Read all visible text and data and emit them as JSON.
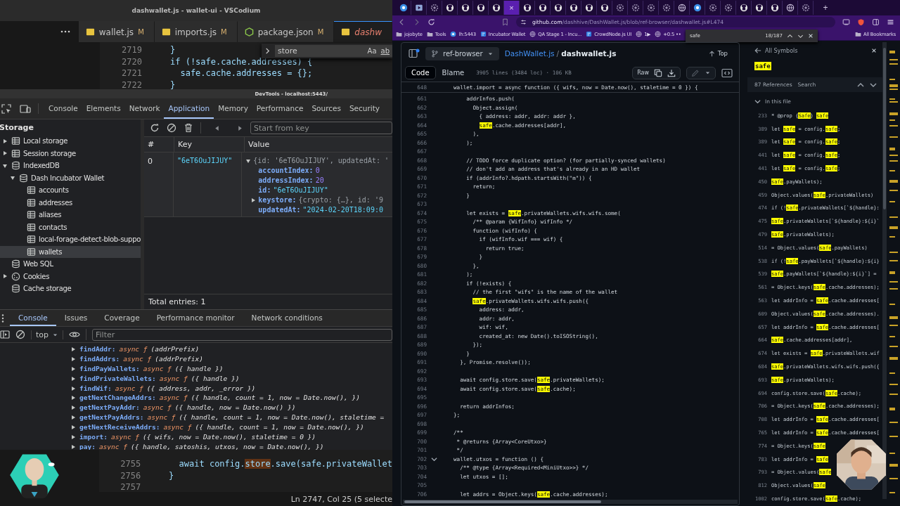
{
  "vscodium": {
    "title": "dashwallet.js - wallet-ui - VSCodium",
    "tabs": [
      {
        "kind": "js",
        "label": "wallet.js",
        "badge": "M",
        "selected": false
      },
      {
        "kind": "js",
        "label": "imports.js",
        "badge": "M",
        "selected": false
      },
      {
        "kind": "json",
        "label": "package.json",
        "badge": "M",
        "selected": false
      },
      {
        "kind": "js",
        "label": "dashw",
        "selected": true
      }
    ],
    "editor_top": [
      {
        "n": "2719",
        "text": "}"
      },
      {
        "n": "2720",
        "text": "if (!safe.cache.addresses) {"
      },
      {
        "n": "2721",
        "text": "  safe.cache.addresses = {};"
      },
      {
        "n": "2722",
        "text": "}"
      }
    ],
    "find": {
      "value": "store",
      "case_toggle": "Aa",
      "word_toggle": "ab"
    },
    "editor_bottom": [
      {
        "n": "2755",
        "parts": [
          "  await config.",
          {
            "match": "store"
          },
          ".save(safe.privateWallet"
        ]
      },
      {
        "n": "2756",
        "parts": [
          "}"
        ]
      },
      {
        "n": "2757"
      }
    ],
    "status": "Ln 2747, Col 25 (5 selecte"
  },
  "devtools": {
    "title": "DevTools - localhost:5443/",
    "tabs": [
      {
        "label": "Console",
        "selected": false
      },
      {
        "label": "Elements",
        "selected": false
      },
      {
        "label": "Network",
        "selected": false
      },
      {
        "label": "Application",
        "selected": true
      },
      {
        "label": "Memory",
        "selected": false
      },
      {
        "label": "Performance",
        "selected": false
      },
      {
        "label": "Sources",
        "selected": false
      },
      {
        "label": "Security",
        "selected": false
      }
    ],
    "sidebar": {
      "heading": "Storage",
      "items": [
        {
          "label": "Local storage",
          "kind": "table",
          "expanded": false,
          "selected": false
        },
        {
          "label": "Session storage",
          "kind": "table",
          "expanded": false,
          "selected": false
        },
        {
          "label": "IndexedDB",
          "kind": "db",
          "expanded": true,
          "selected": false,
          "children": [
            {
              "label": "Dash Incubator Wallet",
              "kind": "db",
              "expanded": true,
              "selected": false,
              "children": [
                {
                  "label": "accounts",
                  "kind": "table",
                  "selected": false
                },
                {
                  "label": "addresses",
                  "kind": "table",
                  "selected": false
                },
                {
                  "label": "aliases",
                  "kind": "table",
                  "selected": false
                },
                {
                  "label": "contacts",
                  "kind": "table",
                  "selected": false
                },
                {
                  "label": "local-forage-detect-blob-suppo",
                  "kind": "table",
                  "selected": false
                },
                {
                  "label": "wallets",
                  "kind": "table",
                  "selected": true
                }
              ]
            }
          ]
        },
        {
          "label": "Web SQL",
          "kind": "db",
          "selected": false
        },
        {
          "label": "Cookies",
          "kind": "cookie",
          "expanded": false,
          "selected": false
        },
        {
          "label": "Cache storage",
          "kind": "db",
          "selected": false
        }
      ]
    },
    "key_filter": {
      "placeholder": "Start from key"
    },
    "table": {
      "columns": [
        "#",
        "Key",
        "Value"
      ],
      "rows": [
        {
          "index": "0",
          "key": "\"6eT6OuJIJUY\"",
          "value": [
            {
              "text": "{id: '6eT6OuJIJUY', updatedAt: '",
              "expanded": true
            },
            {
              "key": "accountIndex:",
              "value": "0",
              "kind": "number"
            },
            {
              "key": "addressIndex:",
              "value": "20",
              "kind": "number"
            },
            {
              "key": "id:",
              "value": "\"6eT6OuJIJUY\"",
              "kind": "string"
            },
            {
              "key": "keystore:",
              "value": "{crypto: {…}, id: '9",
              "kind": "object",
              "expanded": false
            },
            {
              "key": "updatedAt:",
              "value": "\"2024-02-20T18:09:0",
              "kind": "string"
            }
          ]
        }
      ]
    },
    "total": "Total entries: 1",
    "drawer_tabs": [
      {
        "label": "Console",
        "selected": true
      },
      {
        "label": "Issues",
        "selected": false
      },
      {
        "label": "Coverage",
        "selected": false
      },
      {
        "label": "Performance monitor",
        "selected": false
      },
      {
        "label": "Network conditions",
        "selected": false
      }
    ],
    "context": "top",
    "filter": {
      "placeholder": "Filter"
    },
    "console": [
      {
        "name": "findAddr:",
        "type": "async ƒ",
        "params": "(addrPrefix)"
      },
      {
        "name": "findAddrs:",
        "type": "async ƒ",
        "params": "(addrPrefix)"
      },
      {
        "name": "findPayWallets:",
        "type": "async ƒ",
        "params": "({ handle })"
      },
      {
        "name": "findPrivateWallets:",
        "type": "async ƒ",
        "params": "({ handle })"
      },
      {
        "name": "findWif:",
        "type": "async ƒ",
        "params": "({ address, addr, _error })"
      },
      {
        "name": "getNextChangeAddrs:",
        "type": "async ƒ",
        "params": "({ handle, count = 1, now = Date.now(), })"
      },
      {
        "name": "getNextPayAddr:",
        "type": "async ƒ",
        "params": "({ handle, now = Date.now() })"
      },
      {
        "name": "getNextPayAddrs:",
        "type": "async ƒ",
        "params": "({ handle, count = 1, now = Date.now(), staletime ="
      },
      {
        "name": "getNextReceiveAddrs:",
        "type": "async ƒ",
        "params": "({ handle, count = 1, now = Date.now(), })"
      },
      {
        "name": "import:",
        "type": "async ƒ",
        "params": "({ wifs, now = Date.now(), staletime = 0 })"
      },
      {
        "name": "pay:",
        "type": "async ƒ",
        "params": "({ handle, satoshis, utxos, now = Date.now(), })"
      }
    ]
  },
  "browser": {
    "tabs": [
      {
        "kind": "dash",
        "selected": false
      },
      {
        "kind": "media",
        "selected": false
      },
      {
        "kind": "gear",
        "selected": false
      },
      {
        "kind": "github",
        "selected": false
      },
      {
        "kind": "github",
        "selected": false
      },
      {
        "kind": "github",
        "selected": false
      },
      {
        "kind": "github",
        "selected": false
      },
      {
        "selected": true,
        "close": "×"
      },
      {
        "kind": "github",
        "selected": false
      },
      {
        "kind": "github",
        "selected": false
      },
      {
        "kind": "github",
        "selected": false
      },
      {
        "kind": "github",
        "selected": false
      },
      {
        "kind": "github",
        "selected": false
      },
      {
        "kind": "github",
        "selected": false
      },
      {
        "kind": "gear",
        "selected": false
      },
      {
        "kind": "gear",
        "selected": false
      },
      {
        "kind": "gear",
        "selected": false
      },
      {
        "kind": "gear",
        "selected": false
      },
      {
        "kind": "globe",
        "selected": false
      },
      {
        "kind": "dash",
        "selected": false
      },
      {
        "kind": "gear",
        "selected": false
      },
      {
        "kind": "gear",
        "selected": false
      },
      {
        "kind": "github",
        "selected": false
      },
      {
        "kind": "github",
        "selected": false
      },
      {
        "kind": "github",
        "selected": false
      },
      {
        "kind": "globe",
        "selected": false
      },
      {
        "kind": "gear",
        "selected": false
      }
    ],
    "new_tab": "+",
    "url_host": "github.com",
    "url_path": "/dashhive/DashWallet.js/blob/ref-browser/dashwallet.js#L474",
    "bookmarks": [
      {
        "kind": "folder",
        "label": "jojobyte"
      },
      {
        "kind": "folder",
        "label": "Tools"
      },
      {
        "kind": "dash",
        "label": "lh:5443"
      },
      {
        "kind": "app",
        "label": "Incubator Wallet"
      },
      {
        "kind": "globe",
        "label": "QA Stage 1 - Incu..."
      },
      {
        "kind": "app",
        "label": "CrowdNode.js UI"
      },
      {
        "kind": "globe",
        "label": "1▶"
      },
      {
        "kind": "globe",
        "label": "+0.5 ••"
      }
    ],
    "all_bookmarks": "All Bookmarks",
    "find": {
      "value": "safe",
      "count": "18/187"
    },
    "github": {
      "branch": "ref-browser",
      "repo": "DashWallet.js",
      "sep": "/",
      "file": "dashwallet.js",
      "top": "Top",
      "views": [
        {
          "label": "Code",
          "selected": true
        },
        {
          "label": "Blame",
          "selected": false
        }
      ],
      "stats": "3905 lines (3484 loc) · 106 KB",
      "raw": "Raw",
      "sticky": {
        "n": "648",
        "parts": [
          "wallet.import = async function ({ wifs, now = Date.now(), staletime = 0 }) {"
        ]
      },
      "lines": [
        {
          "n": "661",
          "fold": false,
          "parts": [
            "    addrInfos.push("
          ]
        },
        {
          "n": "662",
          "fold": false,
          "parts": [
            "      Object.assign("
          ]
        },
        {
          "n": "663",
          "fold": false,
          "parts": [
            "        { address: addr, addr: addr },"
          ]
        },
        {
          "n": "664",
          "fold": false,
          "parts": [
            {
              "hl": "safe"
            },
            ".cache.addresses[addr],"
          ]
        },
        {
          "n": "665",
          "fold": false,
          "parts": [
            "      ),"
          ]
        },
        {
          "n": "666",
          "fold": false,
          "parts": [
            "    );"
          ]
        },
        {
          "n": "667",
          "fold": false
        },
        {
          "n": "668",
          "fold": false,
          "parts": [
            "    // TODO force duplicate option? (for partially-synced wallets)"
          ]
        },
        {
          "n": "669",
          "fold": false,
          "parts": [
            "    // don't add an address that's already in an HD wallet"
          ]
        },
        {
          "n": "670",
          "fold": false,
          "parts": [
            "    if (addrInfo?.hdpath.startsWith(\"m\")) {"
          ]
        },
        {
          "n": "671",
          "fold": false,
          "parts": [
            "      return;"
          ]
        },
        {
          "n": "672",
          "fold": false,
          "parts": [
            "    }"
          ]
        },
        {
          "n": "673",
          "fold": false
        },
        {
          "n": "674",
          "fold": false,
          "parts": [
            "    let exists = ",
            {
              "hl": "safe"
            },
            ".privateWallets.wifs.wifs.some("
          ]
        },
        {
          "n": "675",
          "fold": false,
          "parts": [
            "      /** @param {WifInfo} wifInfo */"
          ]
        },
        {
          "n": "676",
          "fold": false,
          "parts": [
            "      function (wifInfo) {"
          ]
        },
        {
          "n": "677",
          "fold": false,
          "parts": [
            "        if (wifInfo.wif === wif) {"
          ]
        },
        {
          "n": "678",
          "fold": false,
          "parts": [
            "          return true;"
          ]
        },
        {
          "n": "679",
          "fold": false,
          "parts": [
            "        }"
          ]
        },
        {
          "n": "680",
          "fold": false,
          "parts": [
            "      },"
          ]
        },
        {
          "n": "681",
          "fold": false,
          "parts": [
            "    );"
          ]
        },
        {
          "n": "682",
          "fold": false,
          "parts": [
            "    if (!exists) {"
          ]
        },
        {
          "n": "683",
          "fold": false,
          "parts": [
            "      // the first \"wifs\" is the name of the wallet"
          ]
        },
        {
          "n": "684",
          "fold": false,
          "parts": [
            {
              "hl": "safe"
            },
            ".privateWallets.wifs.wifs.push({"
          ]
        },
        {
          "n": "685",
          "fold": false,
          "parts": [
            "        address: addr,"
          ]
        },
        {
          "n": "686",
          "fold": false,
          "parts": [
            "        addr: addr,"
          ]
        },
        {
          "n": "687",
          "fold": false,
          "parts": [
            "        wif: wif,"
          ]
        },
        {
          "n": "688",
          "fold": false,
          "parts": [
            "        created_at: new Date().toISOString(),"
          ]
        },
        {
          "n": "689",
          "fold": false,
          "parts": [
            "      });"
          ]
        },
        {
          "n": "690",
          "fold": false,
          "parts": [
            "    }"
          ]
        },
        {
          "n": "691",
          "fold": false,
          "parts": [
            "  }, Promise.resolve());"
          ]
        },
        {
          "n": "692",
          "fold": false
        },
        {
          "n": "693",
          "fold": false,
          "parts": [
            "  await config.store.save(",
            {
              "hl": "safe"
            },
            ".privateWallets);"
          ]
        },
        {
          "n": "694",
          "fold": false,
          "parts": [
            "  await config.store.save(",
            {
              "hl": "safe"
            },
            ".cache);"
          ]
        },
        {
          "n": "695",
          "fold": false
        },
        {
          "n": "696",
          "fold": false,
          "parts": [
            "  return addrInfos;"
          ]
        },
        {
          "n": "697",
          "fold": false,
          "parts": [
            "};"
          ]
        },
        {
          "n": "698",
          "fold": false
        },
        {
          "n": "699",
          "fold": false,
          "parts": [
            "/**"
          ]
        },
        {
          "n": "700",
          "fold": false,
          "parts": [
            " * @returns {Array<CoreUtxo>}"
          ]
        },
        {
          "n": "701",
          "fold": false,
          "parts": [
            " */"
          ]
        },
        {
          "n": "702",
          "fold": true,
          "parts": [
            "wallet.utxos = function () {"
          ]
        },
        {
          "n": "703",
          "fold": false,
          "parts": [
            "  /** @type {Array<Required<MiniUtxo>>} */"
          ]
        },
        {
          "n": "704",
          "fold": false,
          "parts": [
            "  let utxos = [];"
          ]
        },
        {
          "n": "705",
          "fold": false
        },
        {
          "n": "706",
          "fold": false,
          "parts": [
            "  let addrs = Object.keys(",
            {
              "hl": "safe"
            },
            ".cache.addresses);"
          ]
        }
      ]
    },
    "symbols": {
      "back": "All Symbols",
      "symbol": "safe",
      "count": "87 References",
      "search": "Search",
      "group": "In this file",
      "refs": [
        {
          "n": "233",
          "parts": [
            "* @prop {",
            {
              "hl": "Safe"
            },
            "} ",
            {
              "hl": "safe"
            }
          ]
        },
        {
          "n": "389",
          "parts": [
            "let ",
            {
              "hl": "safe"
            },
            " = config.",
            {
              "hl": "safe"
            },
            ";"
          ]
        },
        {
          "n": "389",
          "parts": [
            "let ",
            {
              "hl": "safe"
            },
            " = config.",
            {
              "hl": "safe"
            },
            ";"
          ]
        },
        {
          "n": "441",
          "parts": [
            "let ",
            {
              "hl": "safe"
            },
            " = config.",
            {
              "hl": "safe"
            },
            ";"
          ]
        },
        {
          "n": "441",
          "parts": [
            "let ",
            {
              "hl": "safe"
            },
            " = config.",
            {
              "hl": "safe"
            },
            ";"
          ]
        },
        {
          "n": "450",
          "parts": [
            {
              "hl": "safe"
            },
            ".payWallets);"
          ]
        },
        {
          "n": "459",
          "parts": [
            "Object.values(",
            {
              "hl": "safe"
            },
            ".privateWallets)"
          ]
        },
        {
          "n": "474",
          "parts": [
            "if (!",
            {
              "hl": "safe"
            },
            ".privateWallets[`${handle}:"
          ]
        },
        {
          "n": "475",
          "parts": [
            {
              "hl": "safe"
            },
            ".privateWallets[`${handle}:${i}`"
          ]
        },
        {
          "n": "479",
          "parts": [
            {
              "hl": "safe"
            },
            ".privateWallets);"
          ]
        },
        {
          "n": "514",
          "parts": [
            "= Object.values(",
            {
              "hl": "safe"
            },
            ".payWallets)"
          ]
        },
        {
          "n": "538",
          "parts": [
            "if (!",
            {
              "hl": "safe"
            },
            ".payWallets[`${handle}:${i}"
          ]
        },
        {
          "n": "539",
          "parts": [
            {
              "hl": "safe"
            },
            ".payWallets[`${handle}:${i}`] ="
          ]
        },
        {
          "n": "561",
          "parts": [
            "= Object.keys(",
            {
              "hl": "safe"
            },
            ".cache.addresses);"
          ]
        },
        {
          "n": "563",
          "parts": [
            "let addrInfo = ",
            {
              "hl": "safe"
            },
            ".cache.addresses["
          ]
        },
        {
          "n": "609",
          "parts": [
            "Object.values(",
            {
              "hl": "safe"
            },
            ".cache.addresses)."
          ]
        },
        {
          "n": "657",
          "parts": [
            "let addrInfo = ",
            {
              "hl": "safe"
            },
            ".cache.addresses["
          ]
        },
        {
          "n": "664",
          "parts": [
            {
              "hl": "safe"
            },
            ".cache.addresses[addr],"
          ]
        },
        {
          "n": "674",
          "parts": [
            "let exists = ",
            {
              "hl": "safe"
            },
            ".privateWallets.wif"
          ]
        },
        {
          "n": "684",
          "parts": [
            {
              "hl": "safe"
            },
            ".privateWallets.wifs.wifs.push({"
          ]
        },
        {
          "n": "693",
          "parts": [
            {
              "hl": "safe"
            },
            ".privateWallets);"
          ]
        },
        {
          "n": "694",
          "parts": [
            "config.store.save(",
            {
              "hl": "safe"
            },
            ".cache);"
          ]
        },
        {
          "n": "706",
          "parts": [
            "= Object.keys(",
            {
              "hl": "safe"
            },
            ".cache.addresses);"
          ]
        },
        {
          "n": "708",
          "parts": [
            "let addrInfo = ",
            {
              "hl": "safe"
            },
            ".cache.addresses["
          ]
        },
        {
          "n": "765",
          "parts": [
            "let addrInfo = ",
            {
              "hl": "safe"
            },
            ".cache.addresses["
          ]
        },
        {
          "n": "774",
          "parts": [
            "= Object.keys(",
            {
              "hl": "safe"
            }
          ]
        },
        {
          "n": "783",
          "parts": [
            "let addrInfo = ",
            {
              "hl": "safe"
            }
          ]
        },
        {
          "n": "793",
          "parts": [
            "= Object.values(",
            {
              "hl": "safe"
            }
          ]
        },
        {
          "n": "812",
          "parts": [
            "Object.values(",
            {
              "hl": "safe"
            }
          ]
        },
        {
          "n": "1002",
          "parts": [
            "config.store.save(",
            {
              "hl": "safe"
            },
            ".cache);"
          ]
        }
      ]
    }
  }
}
